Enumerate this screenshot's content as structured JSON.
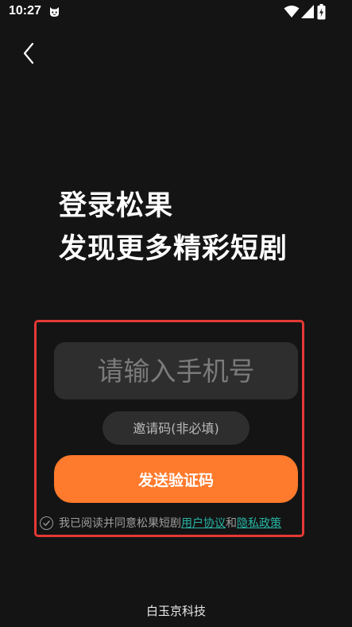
{
  "status_bar": {
    "time": "10:27",
    "app_icon": "cat-face-icon",
    "wifi_icon": "wifi-icon",
    "signal_icon": "cellular-signal-icon",
    "battery_icon": "battery-charging-icon"
  },
  "nav": {
    "back_icon": "back-arrow-icon"
  },
  "headline": {
    "line1": "登录松果",
    "line2": "发现更多精彩短剧"
  },
  "form": {
    "phone_placeholder": "请输入手机号",
    "phone_value": "",
    "invite_placeholder": "邀请码(非必填)",
    "invite_value": "",
    "send_button_label": "发送验证码"
  },
  "agreement": {
    "prefix": "我已阅读并同意松果短剧",
    "user_agreement": "用户协议",
    "joiner": "和",
    "privacy_policy": "隐私政策",
    "checked": false
  },
  "footer": {
    "company": "白玉京科技"
  },
  "colors": {
    "background": "#141414",
    "accent": "#fe7a2c",
    "link": "#26b5a4",
    "highlight_border": "#e53935",
    "input_bg": "#2e2e2e"
  }
}
